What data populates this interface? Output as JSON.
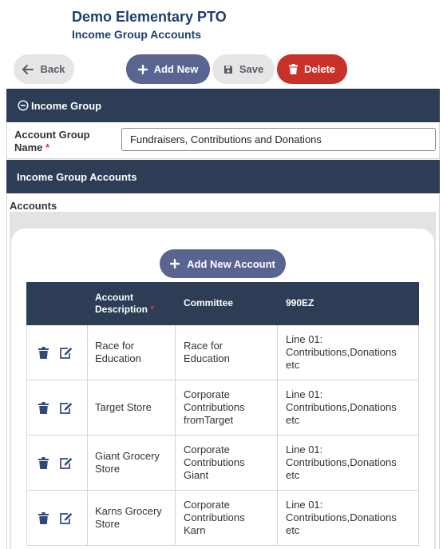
{
  "header": {
    "org_name": "Demo Elementary PTO",
    "page_title": "Income Group Accounts"
  },
  "toolbar": {
    "back_label": "Back",
    "add_new_label": "Add New",
    "save_label": "Save",
    "delete_label": "Delete"
  },
  "income_group_section": {
    "title": "Income Group",
    "icon": "minus-circle-icon",
    "account_group_name_label": "Account Group Name",
    "required_marker": "*",
    "account_group_name_value": "Fundraisers, Contributions and Donations"
  },
  "accounts_section": {
    "title": "Income Group Accounts",
    "accounts_label": "Accounts",
    "add_new_account_label": "Add New Account"
  },
  "accounts_table": {
    "columns": {
      "description": "Account Description",
      "required_marker": "*",
      "committee": "Committee",
      "ez": "990EZ"
    },
    "rows": [
      {
        "description": "Race for\nEducation",
        "committee": "Race for\nEducation",
        "ez": "Line 01:\nContributions,Donations\netc"
      },
      {
        "description": "Target Store",
        "committee": "Corporate\nContributions\nfromTarget",
        "ez": "Line 01:\nContributions,Donations\netc"
      },
      {
        "description": "Giant Grocery\nStore",
        "committee": "Corporate\nContributions\nGiant",
        "ez": "Line 01:\nContributions,Donations\netc"
      },
      {
        "description": "Karns Grocery\nStore",
        "committee": "Corporate\nContributions\nKarn",
        "ez": "Line 01:\nContributions,Donations\netc"
      }
    ]
  },
  "colors": {
    "brand_navy": "#1f3f6b",
    "section_bar": "#2e3d56",
    "primary_button": "#5a6491",
    "danger_button": "#c8302a",
    "neutral_button": "#e6e6e6",
    "required": "#d23b3b",
    "row_icon": "#2f4a75"
  }
}
